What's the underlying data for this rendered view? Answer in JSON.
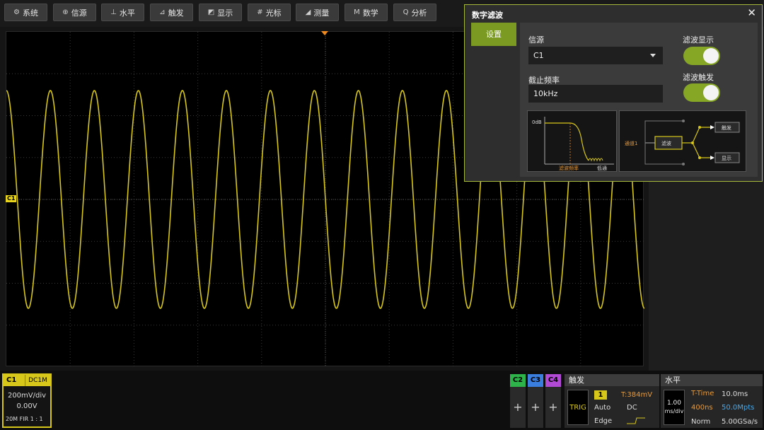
{
  "menu": [
    {
      "label": "系统",
      "icon": "gear-icon",
      "glyph": "⚙"
    },
    {
      "label": "信源",
      "icon": "signal-source-icon",
      "glyph": "⊕"
    },
    {
      "label": "水平",
      "icon": "horizontal-icon",
      "glyph": "⊥"
    },
    {
      "label": "触发",
      "icon": "trigger-icon",
      "glyph": "⊿"
    },
    {
      "label": "显示",
      "icon": "display-icon",
      "glyph": "◩"
    },
    {
      "label": "光标",
      "icon": "cursor-icon",
      "glyph": "#"
    },
    {
      "label": "测量",
      "icon": "measure-icon",
      "glyph": "◢"
    },
    {
      "label": "数学",
      "icon": "math-icon",
      "glyph": "Ⅿ"
    },
    {
      "label": "分析",
      "icon": "analysis-icon",
      "glyph": "Q"
    }
  ],
  "channel_marker": "C1",
  "waveform": {
    "color": "#d7c71a",
    "cycles": 14.5,
    "amplitude_div": 2.6
  },
  "c1": {
    "label": "C1",
    "coupling": "DC1M",
    "scale": "200mV/div",
    "offset": "0.00V",
    "filter": "20M  FIR 1 : 1"
  },
  "channels": [
    {
      "label": "C2",
      "color": "#2db34a",
      "plus": "+"
    },
    {
      "label": "C3",
      "color": "#3a7fe0",
      "plus": "+"
    },
    {
      "label": "C4",
      "color": "#b24ad6",
      "plus": "+"
    }
  ],
  "trigger": {
    "title": "触发",
    "badge": "TRIG",
    "number": "1",
    "level": "T:384mV",
    "mode": "Auto",
    "coupling": "DC",
    "type": "Edge"
  },
  "horizontal": {
    "title": "水平",
    "scale_top": "1.00",
    "scale_unit": "ms/div",
    "ttime_label": "T-Time",
    "ttime": "10.0ms",
    "delay": "400ns",
    "points": "50.0Mpts",
    "mode": "Norm",
    "rate": "5.00GSa/s"
  },
  "dialog": {
    "title": "数字滤波",
    "tab": "设置",
    "source_label": "信源",
    "source_value": "C1",
    "cutoff_label": "截止频率",
    "cutoff_value": "10kHz",
    "filter_display_label": "滤波显示",
    "filter_display_on": true,
    "filter_trigger_label": "滤波触发",
    "filter_trigger_on": true,
    "diagram1": {
      "db": "0dB",
      "xlabel": "滤波频率",
      "xlabel2": "低通"
    },
    "diagram2": {
      "input": "通道1",
      "block": "滤波",
      "out1": "触发",
      "out2": "显示"
    }
  }
}
